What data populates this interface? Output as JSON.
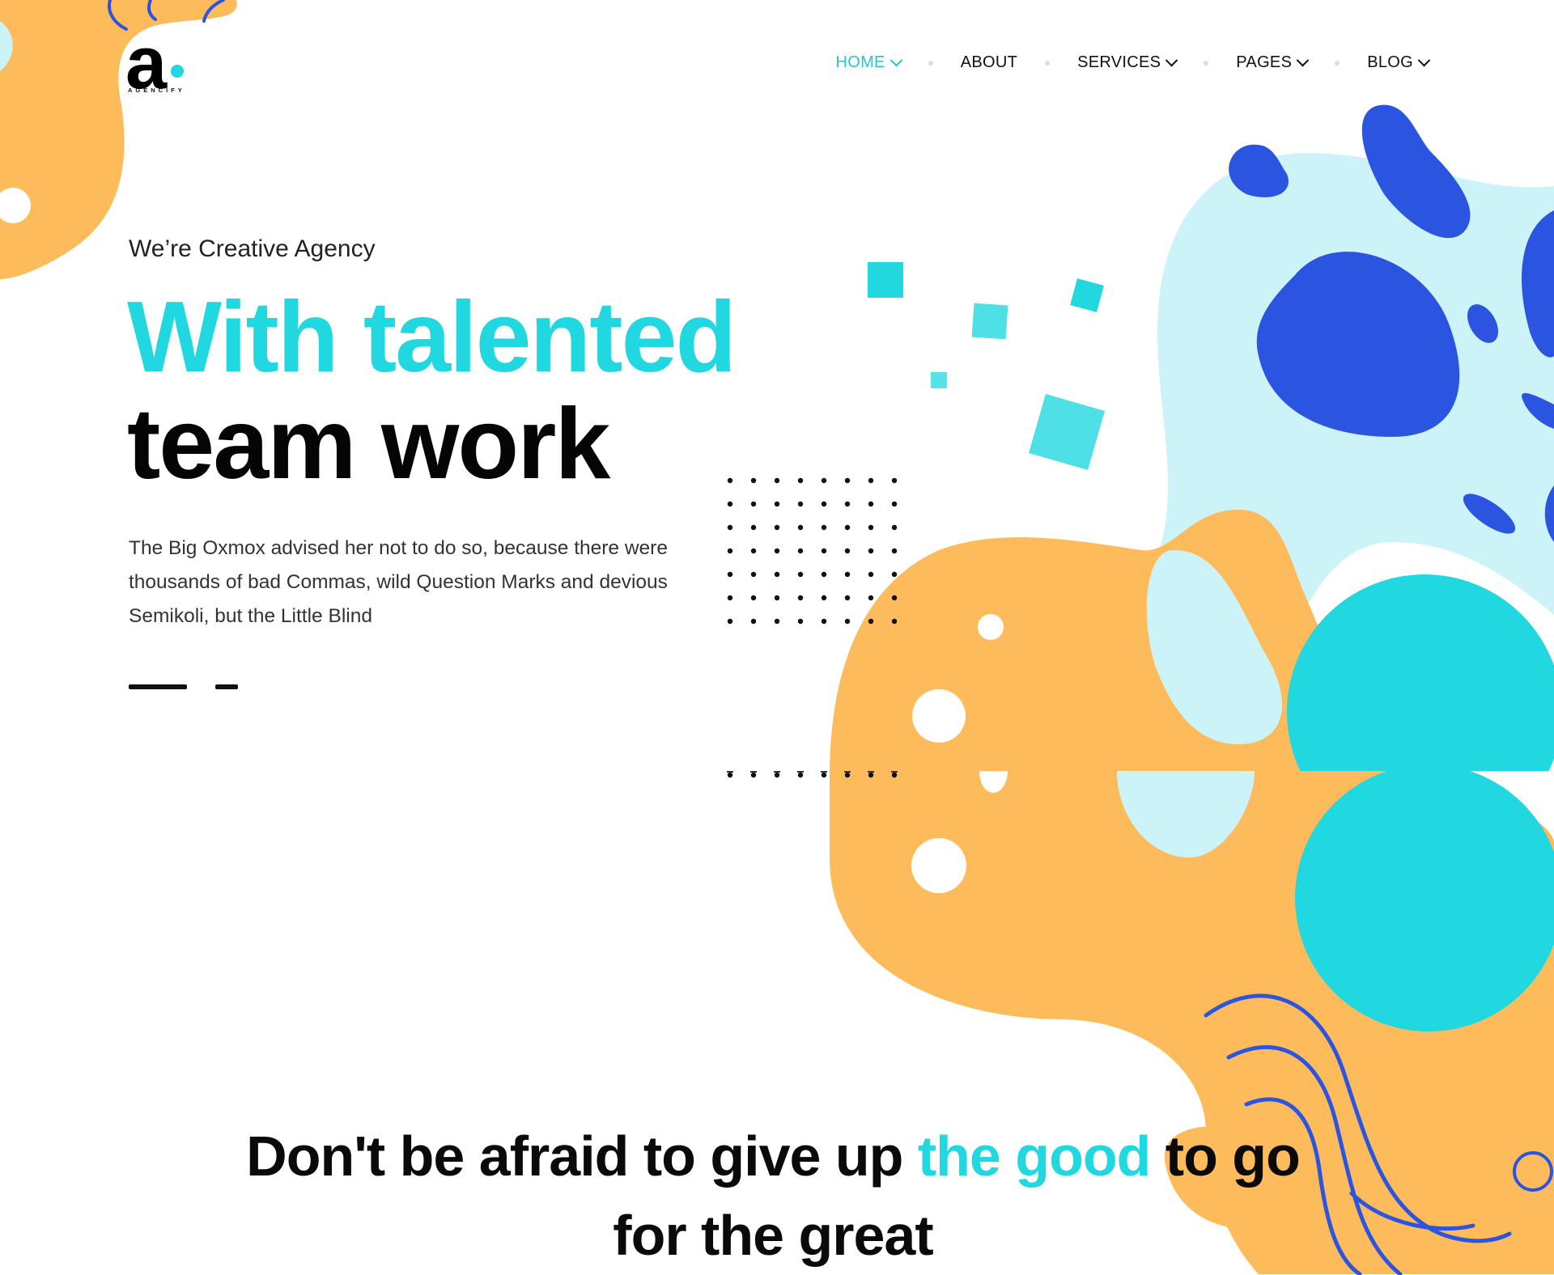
{
  "brand": {
    "letter": "a",
    "wordmark": "AGENCIFY"
  },
  "nav": {
    "items": [
      {
        "label": "HOME",
        "dropdown": true,
        "active": true
      },
      {
        "label": "ABOUT",
        "dropdown": false,
        "active": false
      },
      {
        "label": "SERVICES",
        "dropdown": true,
        "active": false
      },
      {
        "label": "PAGES",
        "dropdown": true,
        "active": false
      },
      {
        "label": "BLOG",
        "dropdown": true,
        "active": false
      }
    ]
  },
  "hero": {
    "eyebrow": "We’re Creative Agency",
    "headline_accent": "With talented",
    "headline_dark": "team work",
    "lead": "The Big Oxmox advised her not to do so, because there were thousands of bad Commas, wild Question Marks and devious Semikoli, but the Little Blind"
  },
  "quote": {
    "part1": "Don't be afraid to give up ",
    "accent": "the good",
    "part2": " to go",
    "line2": "for the great"
  },
  "colors": {
    "accent": "#22d8e0",
    "orange": "#fdbb5c",
    "light_cyan": "#ccf4f8",
    "blue": "#2b55e0",
    "text": "#111111"
  }
}
